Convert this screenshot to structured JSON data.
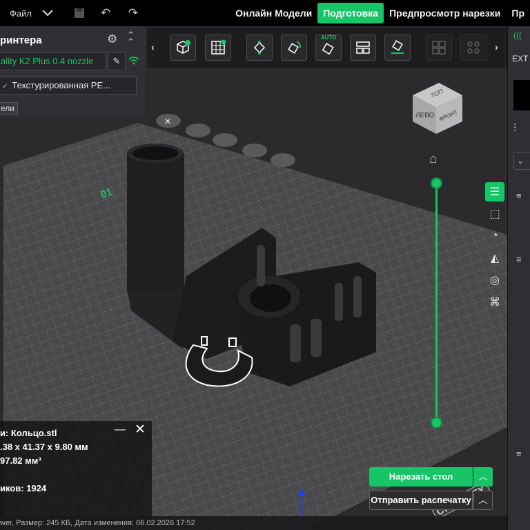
{
  "topbar": {
    "file_label": "Файл",
    "tabs": [
      {
        "label": "Онлайн Модели",
        "active": false
      },
      {
        "label": "Подготовка",
        "active": true
      },
      {
        "label": "Предпросмотр нарезки",
        "active": false
      },
      {
        "label": "Пр",
        "active": false
      }
    ]
  },
  "left_panel": {
    "title": "ринтера",
    "printer": "ality K2 Plus 0.4 nozzle",
    "plate_type": "Текстурированная PE...",
    "models_chip": "ели"
  },
  "toolbar": {
    "auto_label": "AUTO"
  },
  "right_panel": {
    "ext_label": "EXT"
  },
  "viewport": {
    "plate_number": "01",
    "cube_labels": {
      "top": "ТОП",
      "left": "ЛЕВО",
      "front": "ФРОНТ"
    },
    "brand": "CREALITY"
  },
  "info": {
    "name_line": "и: Кольцо.stl",
    "size_line": ".38 x 41.37 x 9.80 мм",
    "volume_line": "97.82 мм³",
    "facets_line": "иков: 1924"
  },
  "actions": {
    "slice_label": "Нарезать стол",
    "send_label": "Отправить распечатку"
  },
  "status": {
    "text": "wer, Размер: 245 КБ, Дата изменения: 06.02.2026 17:52"
  },
  "colors": {
    "accent": "#17c466",
    "background": "#2b2b2d",
    "plate": "#4a4a4c"
  },
  "layer_slider": {
    "top_fraction": 1.0,
    "bottom_fraction": 0.0
  }
}
